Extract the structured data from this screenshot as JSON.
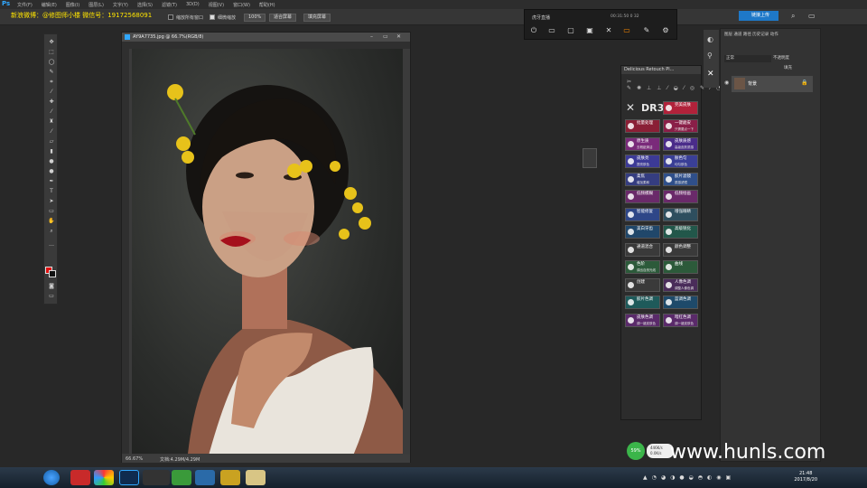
{
  "watermark": "新浪微博：@修图师小楼 微信号：19172568091",
  "menu": [
    "文件(F)",
    "编辑(E)",
    "图像(I)",
    "图层(L)",
    "文字(Y)",
    "选择(S)",
    "滤镜(T)",
    "3D(D)",
    "视图(V)",
    "窗口(W)",
    "帮助(H)"
  ],
  "options": {
    "check1": "缩放所有窗口",
    "check2": "细微缩放",
    "zoom": "100%",
    "fit": "适合屏幕",
    "fill": "填充屏幕"
  },
  "live": {
    "title": "虎牙直播",
    "stats": "00:31:50  0  32"
  },
  "share_button": "链接上传",
  "document": {
    "title": "AY9A7735.jpg @ 66.7%(RGB/8)",
    "zoom": "66.67%",
    "status": "文档:4.29M/4.29M"
  },
  "layers": {
    "tabs": "图层  通道  路径  历史记录  动作",
    "kind": "正常",
    "opacity": "不透明度",
    "fill": "填充",
    "layer_name": "背景"
  },
  "retouch": {
    "title": "Delicious Retouch Pl...",
    "logo": "DR3",
    "buttons": [
      {
        "label": "完美皮肤",
        "sub": "",
        "color": "#b1223a"
      },
      {
        "label": "批量处理",
        "sub": "",
        "color": "#8a1f35"
      },
      {
        "label": "一键磨皮",
        "sub": "只需要点一下",
        "color": "#8a1f48"
      },
      {
        "label": "原生质",
        "sub": "去瑕疵清洁",
        "color": "#7a2a7a"
      },
      {
        "label": "皮肤质感",
        "sub": "高级皮肤质感",
        "color": "#4a2c8a"
      },
      {
        "label": "皮肤亮",
        "sub": "提亮肤色",
        "color": "#3c3a96"
      },
      {
        "label": "肤色匀",
        "sub": "均匀肤色",
        "color": "#3a3f96"
      },
      {
        "label": "柔焦",
        "sub": "增加柔和",
        "color": "#353d80"
      },
      {
        "label": "胶片滤镜",
        "sub": "质感滤镜",
        "color": "#2f4f8a"
      },
      {
        "label": "低频模糊",
        "sub": "",
        "color": "#6a2a6a"
      },
      {
        "label": "低频绘画",
        "sub": "",
        "color": "#6a2a6a"
      },
      {
        "label": "智能修复",
        "sub": "",
        "color": "#2e4688"
      },
      {
        "label": "增强眼睛",
        "sub": "",
        "color": "#2e4e5e"
      },
      {
        "label": "美白牙齿",
        "sub": "",
        "color": "#20476a"
      },
      {
        "label": "高级锐化",
        "sub": "",
        "color": "#22574a"
      },
      {
        "label": "通道混合",
        "sub": "",
        "color": "#3a3a3a"
      },
      {
        "label": "颜色调整",
        "sub": "",
        "color": "#3a3a3a"
      },
      {
        "label": "色阶",
        "sub": "调出自然光线",
        "color": "#2c5a3a"
      },
      {
        "label": "曲线",
        "sub": "",
        "color": "#2c5a3a"
      },
      {
        "label": "创建",
        "sub": "",
        "color": "#3a3a3a"
      },
      {
        "label": "人像色调",
        "sub": "调整人像色调",
        "color": "#4a2c5a"
      },
      {
        "label": "胶片色调",
        "sub": "",
        "color": "#1e5a5a"
      },
      {
        "label": "蓝调色调",
        "sub": "",
        "color": "#1e4a6a"
      },
      {
        "label": "皮肤色调",
        "sub": "调一键皮肤色",
        "color": "#5a2a6a"
      },
      {
        "label": "暗红色调",
        "sub": "调一键皮肤色",
        "color": "#5a2a6a"
      }
    ]
  },
  "overlay_site": "www.hunls.com",
  "speed": "59%",
  "netinfo": [
    "446K/s",
    "0.0K/s"
  ],
  "clock": {
    "time": "21:48",
    "date": "2017/8/20"
  }
}
